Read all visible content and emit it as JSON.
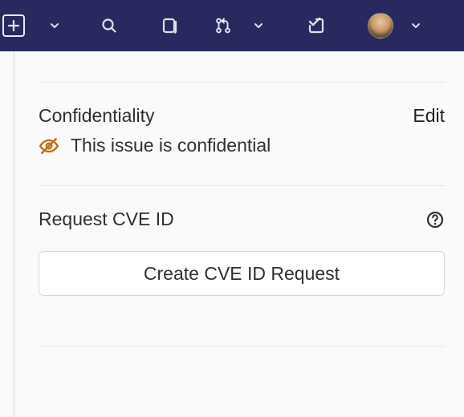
{
  "topbar": {
    "icons": {
      "plus": "plus-icon",
      "plus_chevron": "chevron-down-icon",
      "search": "search-icon",
      "issues": "issues-icon",
      "merge_requests": "merge-request-icon",
      "mr_chevron": "chevron-down-icon",
      "todos": "todo-icon",
      "avatar_chevron": "chevron-down-icon"
    }
  },
  "confidentiality": {
    "title": "Confidentiality",
    "edit": "Edit",
    "message": "This issue is confidential"
  },
  "cve": {
    "title": "Request CVE ID",
    "button": "Create CVE ID Request"
  }
}
